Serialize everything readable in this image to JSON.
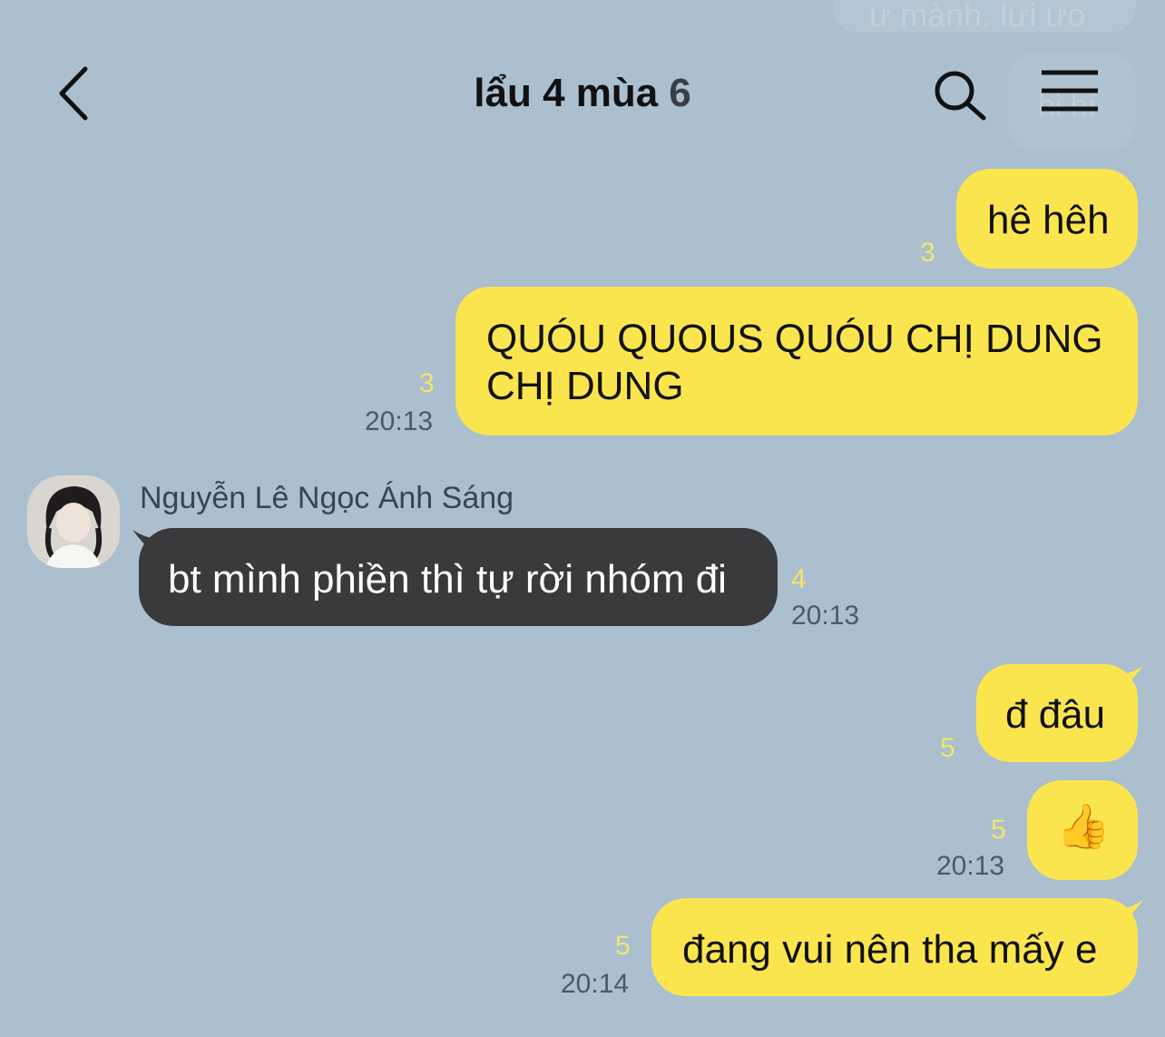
{
  "header": {
    "title": "lẩu 4 mùa",
    "member_count": "6",
    "ghost_top_text": "ư mành. lưi ưo",
    "ghost_right_text": "hi hí"
  },
  "messages": [
    {
      "side": "me",
      "text": "hê hêh",
      "unread": "3",
      "time": ""
    },
    {
      "side": "me",
      "lines": [
        "QUÓU QUOUS QUÓU CHỊ DUNG",
        "CHỊ DUNG"
      ],
      "unread": "3",
      "time": "20:13"
    },
    {
      "side": "them",
      "sender": "Nguyễn Lê Ngọc Ánh Sáng",
      "text": "bt mình phiền thì tự rời nhóm đi",
      "unread": "4",
      "time": "20:13"
    },
    {
      "side": "me",
      "text": "đ đâu",
      "unread": "5",
      "time": ""
    },
    {
      "side": "me",
      "text": "👍",
      "unread": "5",
      "time": "20:13"
    },
    {
      "side": "me",
      "text": "đang vui nên tha mấy e",
      "unread": "5",
      "time": "20:14"
    }
  ],
  "icons": {
    "back": "chevron-left-icon",
    "search": "search-icon",
    "menu": "hamburger-menu-icon"
  },
  "colors": {
    "background": "#abbfcf",
    "my_bubble": "#fae54f",
    "their_bubble": "#3a3a3c",
    "unread_count": "#f4e56a"
  }
}
